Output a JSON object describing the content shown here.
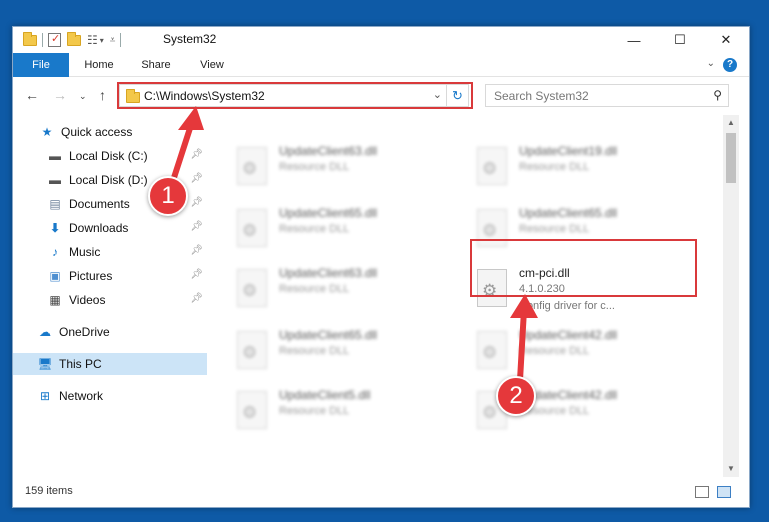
{
  "window": {
    "title": "System32"
  },
  "ribbon": {
    "tabs": [
      "File",
      "Home",
      "Share",
      "View"
    ]
  },
  "nav": {
    "address": "C:\\Windows\\System32",
    "search_placeholder": "Search System32"
  },
  "sidebar": {
    "items": [
      {
        "label": "Quick access",
        "icon": "star-icon"
      },
      {
        "label": "Local Disk (C:)",
        "icon": "drive-icon"
      },
      {
        "label": "Local Disk (D:)",
        "icon": "drive-icon"
      },
      {
        "label": "Documents",
        "icon": "documents-icon"
      },
      {
        "label": "Downloads",
        "icon": "download-icon"
      },
      {
        "label": "Music",
        "icon": "music-icon"
      },
      {
        "label": "Pictures",
        "icon": "pictures-icon"
      },
      {
        "label": "Videos",
        "icon": "videos-icon"
      },
      {
        "label": "OneDrive",
        "icon": "cloud-icon"
      },
      {
        "label": "This PC",
        "icon": "computer-icon"
      },
      {
        "label": "Network",
        "icon": "network-icon"
      }
    ]
  },
  "files": [
    {
      "name": "UpdateClient63.dll",
      "desc": "Resource DLL"
    },
    {
      "name": "UpdateClient19.dll",
      "desc": "Resource DLL"
    },
    {
      "name": "UpdateClient65.dll",
      "desc": "Resource DLL"
    },
    {
      "name": "UpdateClient65.dll",
      "desc": "Resource DLL"
    },
    {
      "name": "UpdateClient63.dll",
      "desc": "Resource DLL"
    },
    {
      "name": "cm-pci.dll",
      "desc": "4.1.0.230",
      "desc2": "Config driver for c..."
    },
    {
      "name": "UpdateClient65.dll",
      "desc": "Resource DLL"
    },
    {
      "name": "UpdateClient42.dll",
      "desc": "Resource DLL"
    },
    {
      "name": "UpdateClient5.dll",
      "desc": "Resource DLL"
    },
    {
      "name": "UpdateClient42.dll",
      "desc": "Resource DLL"
    }
  ],
  "status": {
    "count": "159 items"
  },
  "annotations": {
    "step1": "1",
    "step2": "2",
    "color": "#e5383b"
  },
  "colors": {
    "accent": "#1979ca",
    "selection": "#cce4f7",
    "highlight": "#d9393b"
  }
}
